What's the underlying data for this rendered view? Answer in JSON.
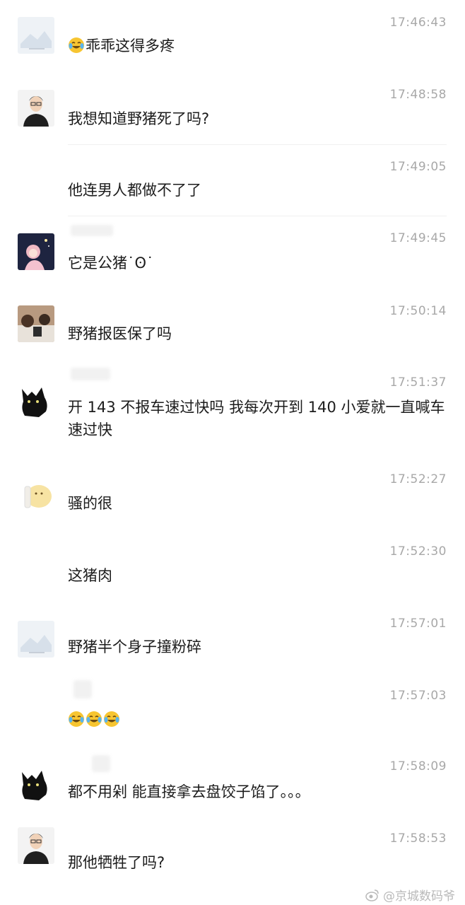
{
  "messages": [
    {
      "time": "17:46:43",
      "text": "乖乖这得多疼",
      "avatar": "landscape-card-avatar",
      "emoji_prefix": 1
    },
    {
      "time": "17:48:58",
      "text": "我想知道野猪死了吗?",
      "avatar": "man-glasses-avatar"
    },
    {
      "time": "17:49:05",
      "text": "他连男人都做不了了"
    },
    {
      "time": "17:49:45",
      "text": "它是公猪˙ʘ˙",
      "avatar": "anime-girl-avatar"
    },
    {
      "time": "17:50:14",
      "text": "野猪报医保了吗",
      "avatar": "photo-scene-avatar"
    },
    {
      "time": "17:51:37",
      "text": "开 143 不报车速过快吗  我每次开到 140 小爱就一直喊车速过快",
      "avatar": "black-cat-avatar"
    },
    {
      "time": "17:52:27",
      "text": "骚的很",
      "avatar": "cartoon-blob-avatar"
    },
    {
      "time": "17:52:30",
      "text": "这猪肉"
    },
    {
      "time": "17:57:01",
      "text": "野猪半个身子撞粉碎",
      "avatar": "landscape-card-avatar"
    },
    {
      "time": "17:57:03",
      "text": "",
      "emoji_count": 3
    },
    {
      "time": "17:58:09",
      "text": "都不用剁  能直接拿去盘饺子馅了。。。",
      "avatar": "black-cat-avatar"
    },
    {
      "time": "17:58:53",
      "text": "那他牺牲了吗?",
      "avatar": "man-glasses-avatar"
    }
  ],
  "watermark": "@京城数码爷",
  "icons": {
    "emoji": "laughing-crying-emoji-icon",
    "watermark": "weibo-icon"
  },
  "colors": {
    "time": "#a8a8a8",
    "text": "#1c1c1c",
    "background": "#ffffff"
  }
}
